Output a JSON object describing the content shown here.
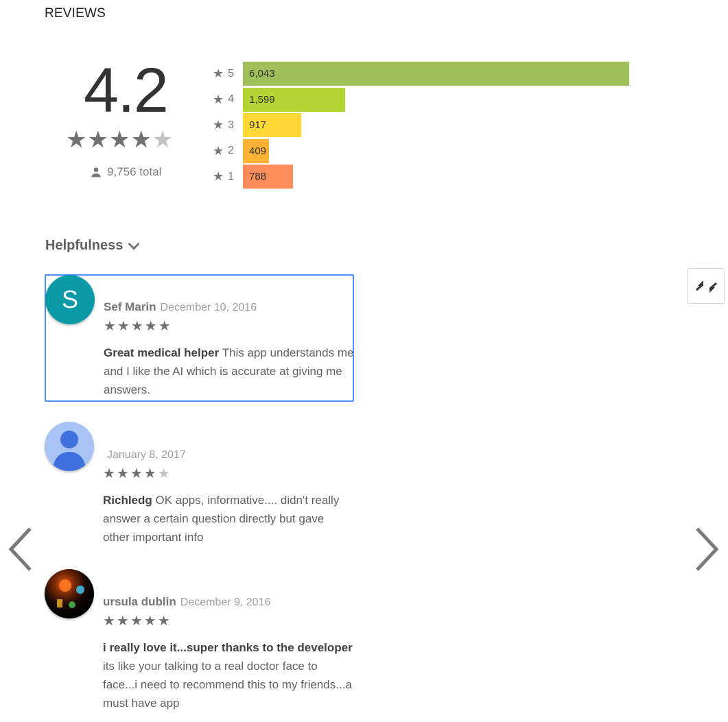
{
  "section": {
    "heading": "REVIEWS"
  },
  "summary": {
    "average": "4.2",
    "total": "9,756 total",
    "stars": 4.2,
    "bars": [
      {
        "star": "5",
        "count": "6,043",
        "color": "#9fc05a",
        "value": 6043
      },
      {
        "star": "4",
        "count": "1,599",
        "color": "#b3d431",
        "value": 1599
      },
      {
        "star": "3",
        "count": "917",
        "color": "#ffd835",
        "value": 917
      },
      {
        "star": "2",
        "count": "409",
        "color": "#ffb234",
        "value": 409
      },
      {
        "star": "1",
        "count": "788",
        "color": "#ff8c5a",
        "value": 788
      }
    ]
  },
  "sort": {
    "label": "Helpfulness"
  },
  "reviews": [
    {
      "author": "Sef Marin",
      "date": "December 10, 2016",
      "rating": 5,
      "title": "Great medical helper",
      "body": " This app understands me and I like the AI which is accurate at giving me answers.",
      "avatar_letter": "S"
    },
    {
      "author": "",
      "date": "January 8, 2017",
      "rating": 4,
      "title": "Richledg",
      "body": " OK apps, informative.... didn't really answer a certain question directly but gave other important info"
    },
    {
      "author": "ursula dublin",
      "date": "December 9, 2016",
      "rating": 5,
      "title": "i really love it...super thanks to the developer",
      "body": " its like your talking to a real doctor face to face...i need to recommend this to my friends...a must have app"
    }
  ],
  "icons": {
    "star": "star-icon",
    "person": "person-icon",
    "collapse": "collapse-icon",
    "prev": "chevron-left-icon",
    "next": "chevron-right-icon"
  },
  "colors": {
    "focus": "#4d90fe",
    "avatar_s": "#0c9aa6"
  }
}
